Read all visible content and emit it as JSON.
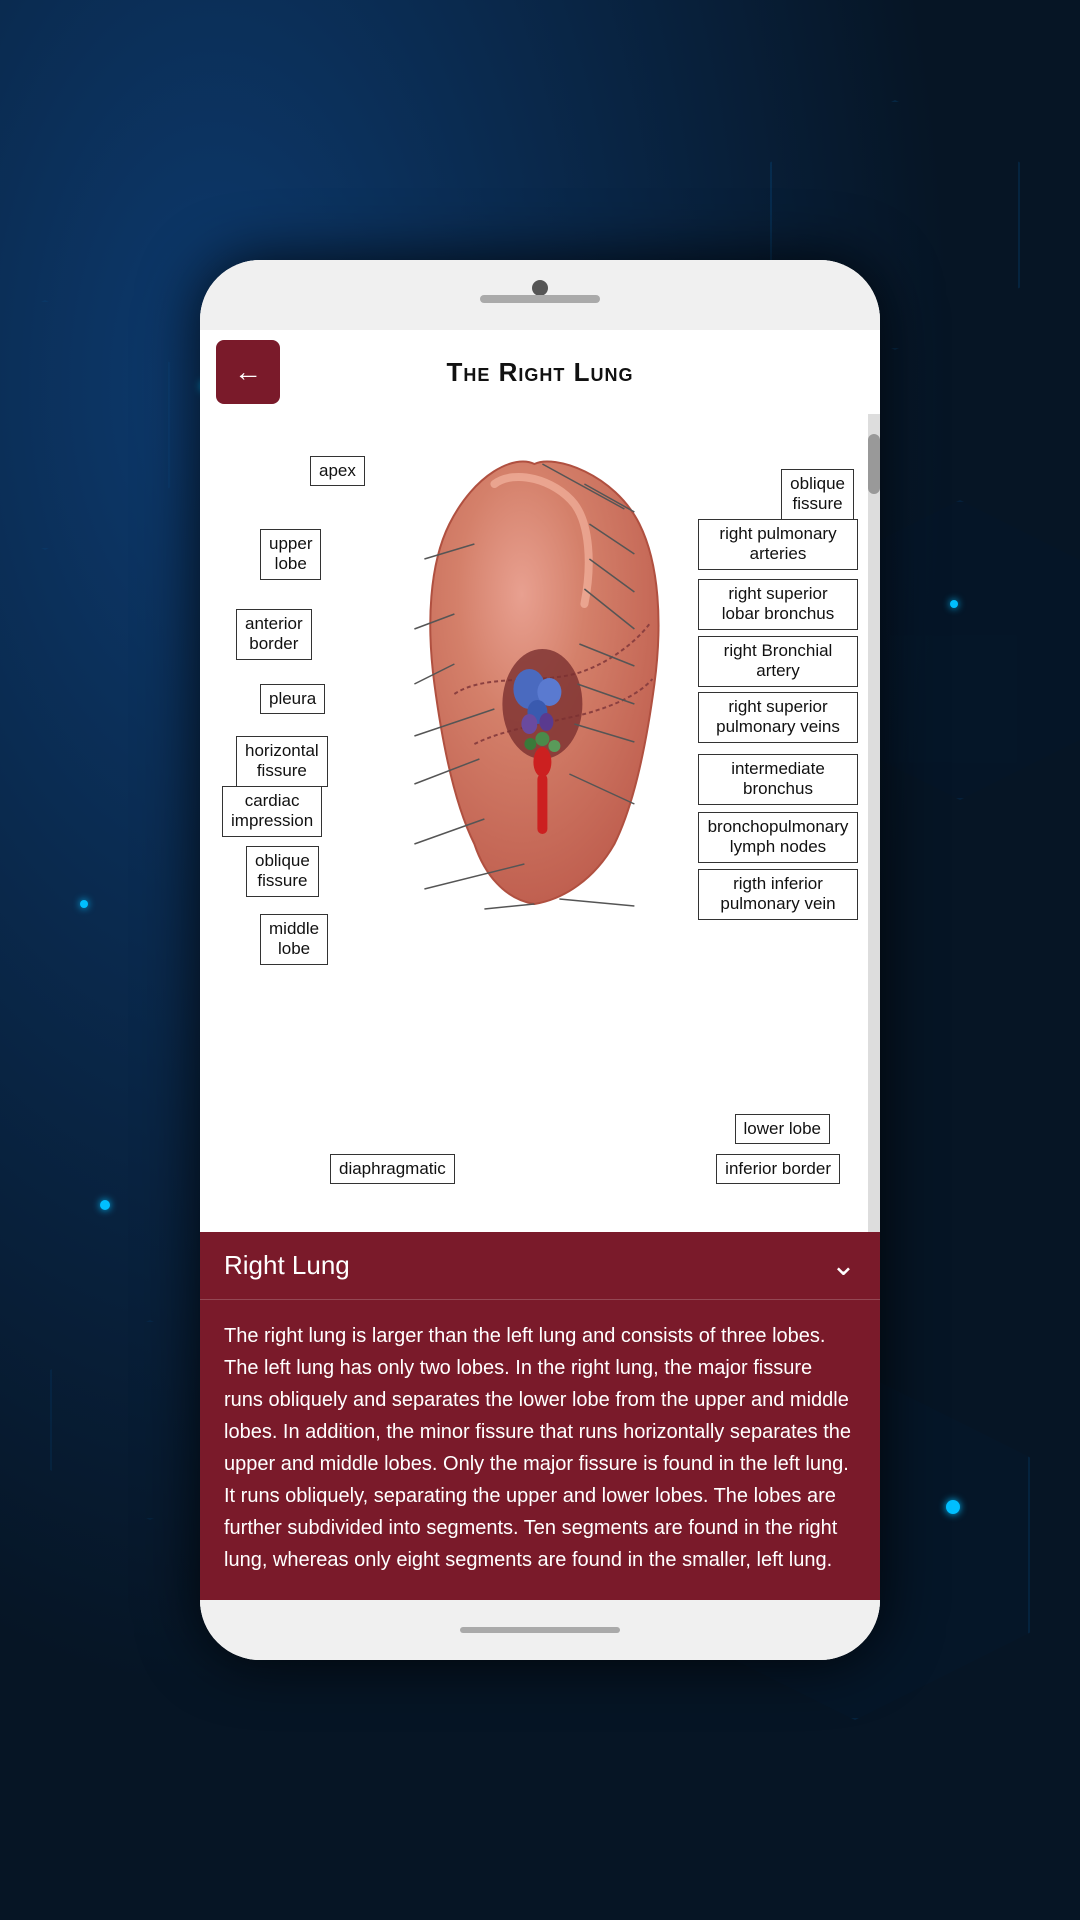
{
  "background": {
    "color": "#0a1f3a"
  },
  "phone": {
    "camera": "camera",
    "speaker": "speaker"
  },
  "header": {
    "back_label": "←",
    "title": "The Right Lung"
  },
  "diagram": {
    "labels_left": [
      {
        "id": "apex",
        "text": "apex"
      },
      {
        "id": "upper-lobe",
        "text": "upper\nlobe"
      },
      {
        "id": "anterior-border",
        "text": "anterior\nborder"
      },
      {
        "id": "pleura",
        "text": "pleura"
      },
      {
        "id": "horizontal-fissure",
        "text": "horizontal\nfissure"
      },
      {
        "id": "cardiac-impression",
        "text": "cardiac\nimpression"
      },
      {
        "id": "oblique-fissure",
        "text": "oblique\nfissure"
      },
      {
        "id": "middle-lobe",
        "text": "middle\nlobe"
      }
    ],
    "labels_right": [
      {
        "id": "oblique-fissure-r",
        "text": "oblique\nfissure"
      },
      {
        "id": "right-pulmonary-arteries",
        "text": "right pulmonary\narteries"
      },
      {
        "id": "right-superior-lobar-bronchus",
        "text": "right superior\nlobar bronchus"
      },
      {
        "id": "right-bronchial-artery",
        "text": "right Bronchial\nartery"
      },
      {
        "id": "right-superior-pulmonary-veins",
        "text": "right superior\npulmonary veins"
      },
      {
        "id": "intermediate-bronchus",
        "text": "intermediate\nbronchus"
      },
      {
        "id": "bronchopulmonary-lymph-nodes",
        "text": "bronchopulmonary\nlymph nodes"
      },
      {
        "id": "rigth-inferior-pulmonary-vein",
        "text": "rigth inferior\npulmonary vein"
      }
    ],
    "labels_bottom": [
      {
        "id": "lower-lobe",
        "text": "lower lobe"
      },
      {
        "id": "inferior-border",
        "text": "inferior border"
      },
      {
        "id": "diaphragmatic",
        "text": "diaphragmatic"
      }
    ]
  },
  "info_panel": {
    "title": "Right Lung",
    "chevron": "⌄",
    "description": "The right lung is larger than the left lung and consists of three lobes. The left lung has only two lobes. In the right lung, the major fissure runs obliquely and separates the lower lobe from the upper and middle lobes. In addition, the minor fissure that runs horizontally separates the upper and middle lobes. Only the major fissure is found in the left lung. It runs obliquely, separating the upper and lower lobes. The lobes are further subdivided into segments. Ten segments are found in the right lung, whereas only eight segments are found in the smaller, left lung."
  }
}
